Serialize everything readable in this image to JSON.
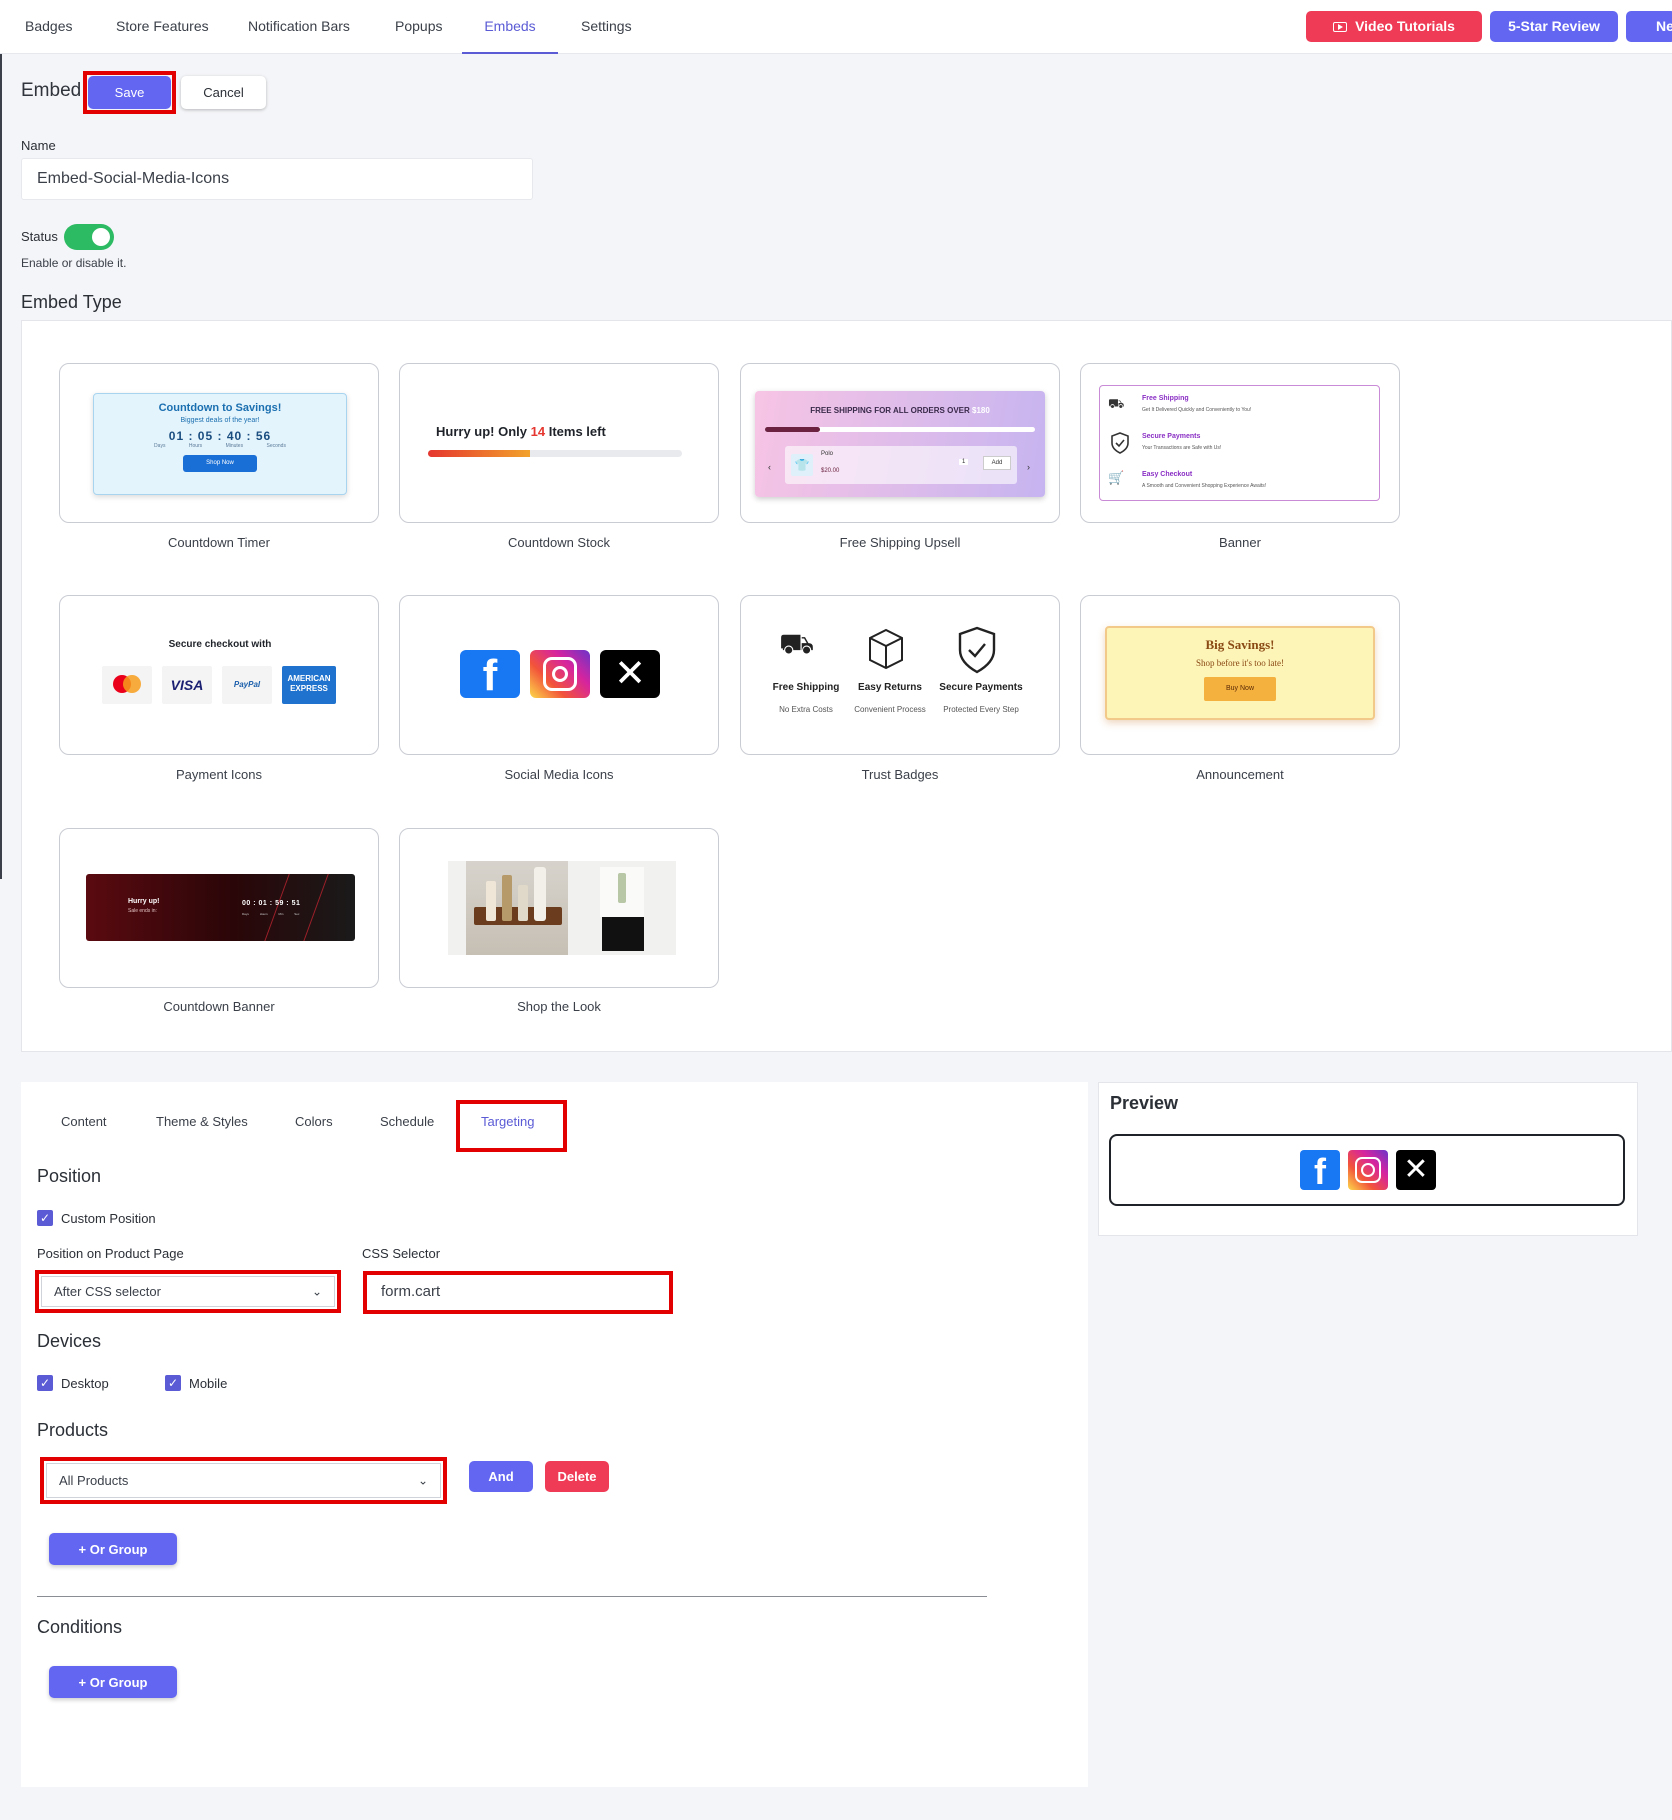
{
  "nav": {
    "tabs": [
      "Badges",
      "Store Features",
      "Notification Bars",
      "Popups",
      "Embeds",
      "Settings"
    ],
    "active_tab": "Embeds",
    "video_tutorials": "Video Tutorials",
    "five_star_review": "5-Star Review",
    "cut_off_button": "Ne"
  },
  "header": {
    "title": "Embed",
    "save": "Save",
    "cancel": "Cancel"
  },
  "name_field": {
    "label": "Name",
    "value": "Embed-Social-Media-Icons"
  },
  "status": {
    "label": "Status",
    "help": "Enable or disable it.",
    "enabled": true
  },
  "embed_type": {
    "title": "Embed Type",
    "cards": [
      {
        "label": "Countdown Timer",
        "thumb": {
          "heading": "Countdown to Savings!",
          "sub": "Biggest deals of the year!",
          "digits": [
            "01",
            "05",
            "40",
            "56"
          ],
          "units": [
            "Days",
            "Hours",
            "Minutes",
            "Seconds"
          ],
          "button": "Shop Now"
        }
      },
      {
        "label": "Countdown Stock",
        "thumb": {
          "prefix": "Hurry up! Only",
          "count": "14",
          "suffix": "Items left",
          "fill_percent": 40
        }
      },
      {
        "label": "Free Shipping Upsell",
        "thumb": {
          "heading": "FREE SHIPPING FOR ALL ORDERS OVER",
          "amount": "$180",
          "product": "Polo",
          "price": "$20.00",
          "qty": "1",
          "add": "Add"
        }
      },
      {
        "label": "Banner",
        "thumb": {
          "items": [
            {
              "title": "Free Shipping",
              "desc": "Get It Delivered Quickly and Conveniently to You!",
              "icon": "truck-icon"
            },
            {
              "title": "Secure Payments",
              "desc": "Your Transactions are Safe with Us!",
              "icon": "shield-check-icon"
            },
            {
              "title": "Easy Checkout",
              "desc": "A Smooth and Convenient Shopping Experience Awaits!",
              "icon": "cart-icon"
            }
          ]
        }
      },
      {
        "label": "Payment Icons",
        "thumb": {
          "heading": "Secure checkout with",
          "cards": [
            "mastercard",
            "VISA",
            "PayPal",
            "AMERICAN EXPRESS"
          ]
        }
      },
      {
        "label": "Social Media Icons",
        "thumb": {
          "icons": [
            "facebook-icon",
            "instagram-icon",
            "x-icon"
          ]
        }
      },
      {
        "label": "Trust Badges",
        "thumb": {
          "items": [
            {
              "title": "Free Shipping",
              "desc": "No Extra Costs",
              "icon": "truck-icon"
            },
            {
              "title": "Easy Returns",
              "desc": "Convenient Process",
              "icon": "box-icon"
            },
            {
              "title": "Secure Payments",
              "desc": "Protected Every Step",
              "icon": "shield-check-icon"
            }
          ]
        }
      },
      {
        "label": "Announcement",
        "thumb": {
          "heading": "Big Savings!",
          "sub": "Shop before it's too late!",
          "button": "Buy Now"
        }
      },
      {
        "label": "Countdown Banner",
        "thumb": {
          "heading": "Hurry up!",
          "sub": "Sale ends in:",
          "digits": [
            "00",
            "01",
            "59",
            "51"
          ],
          "units": [
            "Days",
            "Hours",
            "Min",
            "Sec"
          ]
        }
      },
      {
        "label": "Shop the Look",
        "thumb": {
          "image": "product-photo"
        }
      }
    ]
  },
  "settings": {
    "tabs": [
      "Content",
      "Theme & Styles",
      "Colors",
      "Schedule",
      "Targeting"
    ],
    "active_tab": "Targeting",
    "position": {
      "title": "Position",
      "custom_position": {
        "label": "Custom Position",
        "checked": true
      },
      "product_page": {
        "label": "Position on Product Page",
        "value": "After CSS selector"
      },
      "css_selector": {
        "label": "CSS Selector",
        "value": "form.cart"
      }
    },
    "devices": {
      "title": "Devices",
      "desktop": {
        "label": "Desktop",
        "checked": true
      },
      "mobile": {
        "label": "Mobile",
        "checked": true
      }
    },
    "products": {
      "title": "Products",
      "select": "All Products",
      "and": "And",
      "delete": "Delete",
      "or_group": "+ Or Group"
    },
    "conditions": {
      "title": "Conditions",
      "or_group": "+ Or Group"
    }
  },
  "preview": {
    "title": "Preview",
    "icons": [
      "facebook-icon",
      "instagram-icon",
      "x-icon"
    ]
  },
  "colors": {
    "accent": "#5b5bd6",
    "red": "#ef3b55",
    "green": "#2cba62",
    "highlight": "#e30000",
    "facebook": "#1877f2",
    "instagram": "#d6249f",
    "x": "#000000"
  }
}
